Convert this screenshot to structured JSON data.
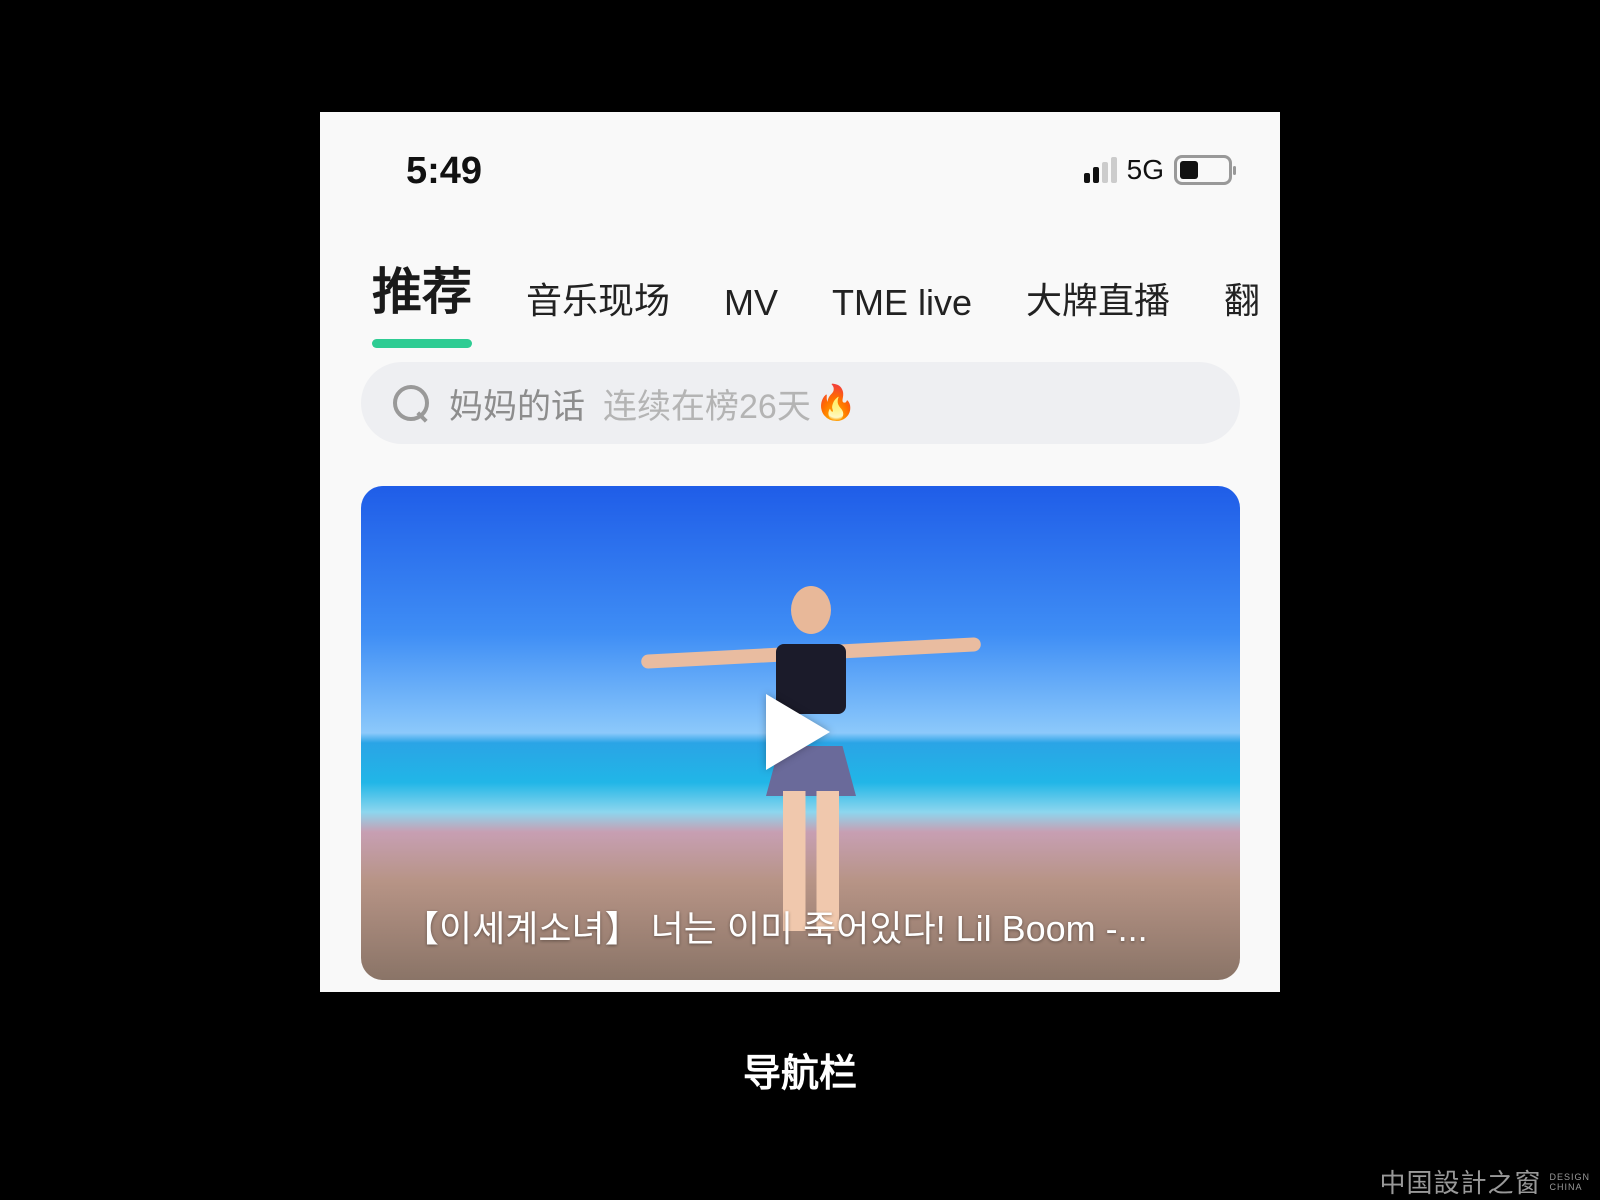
{
  "status_bar": {
    "time": "5:49",
    "network": "5G",
    "signal_bars": 2,
    "battery_level": 0.4
  },
  "tabs": [
    {
      "label": "推荐",
      "active": true
    },
    {
      "label": "音乐现场"
    },
    {
      "label": "MV"
    },
    {
      "label": "TME live"
    },
    {
      "label": "大牌直播"
    },
    {
      "label": "翻"
    }
  ],
  "search": {
    "keyword": "妈妈的话",
    "hint": "连续在榜26天",
    "emoji": "🔥"
  },
  "video": {
    "title": "【이세계소녀】 너는 이미 죽어있다! Lil Boom -..."
  },
  "caption": "导航栏",
  "watermark": {
    "cn": "中国設計之窗",
    "en1": "DESIGN",
    "en2": "CHINA"
  },
  "colors": {
    "accent": "#2ecc93",
    "background": "#000000"
  }
}
